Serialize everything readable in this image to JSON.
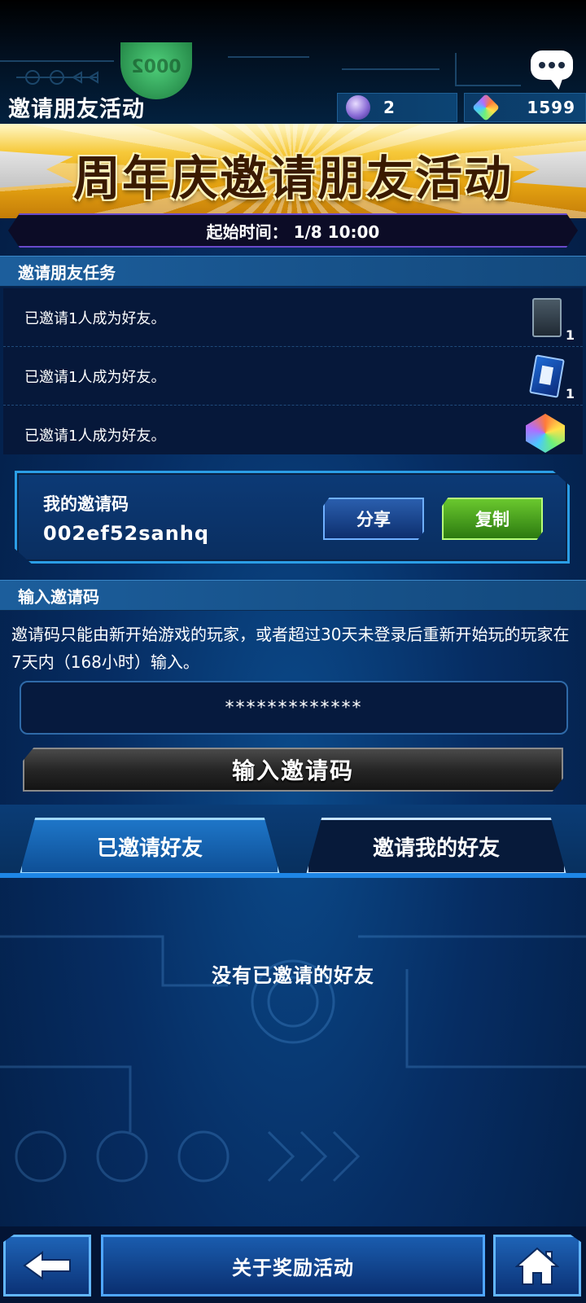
{
  "header": {
    "title": "邀请朋友活动",
    "orb_count": "2",
    "gem_count": "1599",
    "chat_icon": "chat-bubble-icon"
  },
  "banner": {
    "title": "周年庆邀请朋友活动",
    "start_time": "起始时间： 1/8 10:00"
  },
  "missions": {
    "header": "邀请朋友任务",
    "items": [
      {
        "text": "已邀请1人成为好友。",
        "reward_icon": "card-pack-icon",
        "count": "1"
      },
      {
        "text": "已邀请1人成为好友。",
        "reward_icon": "card-ticket-icon",
        "count": "1"
      },
      {
        "text": "已邀请1人成为好友。",
        "reward_icon": "gem-icon",
        "count": ""
      }
    ]
  },
  "my_code": {
    "label": "我的邀请码",
    "code": "002ef52sanhq",
    "share_label": "分享",
    "copy_label": "复制"
  },
  "input_code": {
    "header": "输入邀请码",
    "description": "邀请码只能由新开始游戏的玩家，或者超过30天未登录后重新开始玩的玩家在7天内（168小时）输入。",
    "value": "*************",
    "button_label": "输入邀请码"
  },
  "tabs": {
    "invited_label": "已邀请好友",
    "inviter_label": "邀请我的好友"
  },
  "empty_message": "没有已邀请的好友",
  "footer": {
    "rewards_label": "关于奖励活动",
    "back_icon": "back-arrow-icon",
    "home_icon": "home-icon"
  }
}
